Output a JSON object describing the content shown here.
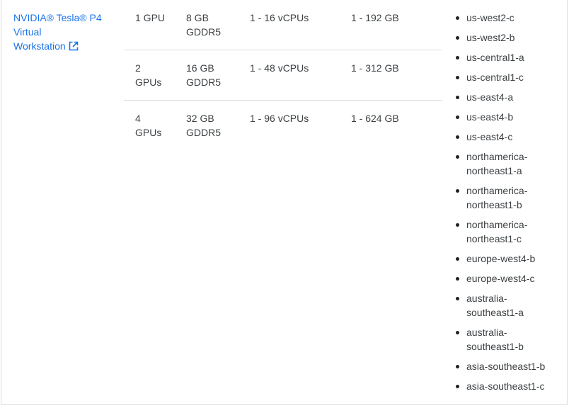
{
  "gpu_model": {
    "name_line1": "NVIDIA® Tesla® P4",
    "name_line2": "Virtual",
    "name_line3": "Workstation",
    "link_icon": "external-link-icon"
  },
  "configurations": [
    {
      "gpus_line1": "1 GPU",
      "gpus_line2": "",
      "memory_line1": "8 GB",
      "memory_line2": "GDDR5",
      "vcpus": "1 - 16 vCPUs",
      "system_memory": "1 - 192 GB"
    },
    {
      "gpus_line1": "2",
      "gpus_line2": "GPUs",
      "memory_line1": "16 GB",
      "memory_line2": "GDDR5",
      "vcpus": "1 - 48 vCPUs",
      "system_memory": "1 - 312 GB"
    },
    {
      "gpus_line1": "4",
      "gpus_line2": "GPUs",
      "memory_line1": "32 GB",
      "memory_line2": "GDDR5",
      "vcpus": "1 - 96 vCPUs",
      "system_memory": "1 - 624 GB"
    }
  ],
  "zones": [
    {
      "line1": "us-west2-c",
      "line2": ""
    },
    {
      "line1": "us-west2-b",
      "line2": ""
    },
    {
      "line1": "us-central1-a",
      "line2": ""
    },
    {
      "line1": "us-central1-c",
      "line2": ""
    },
    {
      "line1": "us-east4-a",
      "line2": ""
    },
    {
      "line1": "us-east4-b",
      "line2": ""
    },
    {
      "line1": "us-east4-c",
      "line2": ""
    },
    {
      "line1": "northamerica-",
      "line2": "northeast1-a"
    },
    {
      "line1": "northamerica-",
      "line2": "northeast1-b"
    },
    {
      "line1": "northamerica-",
      "line2": "northeast1-c"
    },
    {
      "line1": "europe-west4-b",
      "line2": ""
    },
    {
      "line1": "europe-west4-c",
      "line2": ""
    },
    {
      "line1": "australia-",
      "line2": "southeast1-a"
    },
    {
      "line1": "australia-",
      "line2": "southeast1-b"
    },
    {
      "line1": "asia-southeast1-b",
      "line2": ""
    },
    {
      "line1": "asia-southeast1-c",
      "line2": ""
    }
  ]
}
